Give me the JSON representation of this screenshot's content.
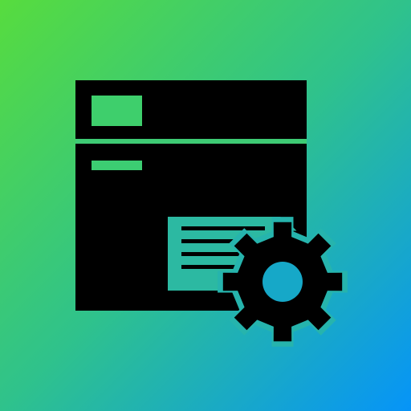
{
  "icon": {
    "name": "app-settings-icon",
    "parts": [
      "window-icon",
      "document-icon",
      "gear-icon"
    ]
  },
  "colors": {
    "gradient_top_left": "#57dc3e",
    "gradient_mid": "#2fc28c",
    "gradient_bottom_right": "#0694f8",
    "glyph": "#000000"
  }
}
